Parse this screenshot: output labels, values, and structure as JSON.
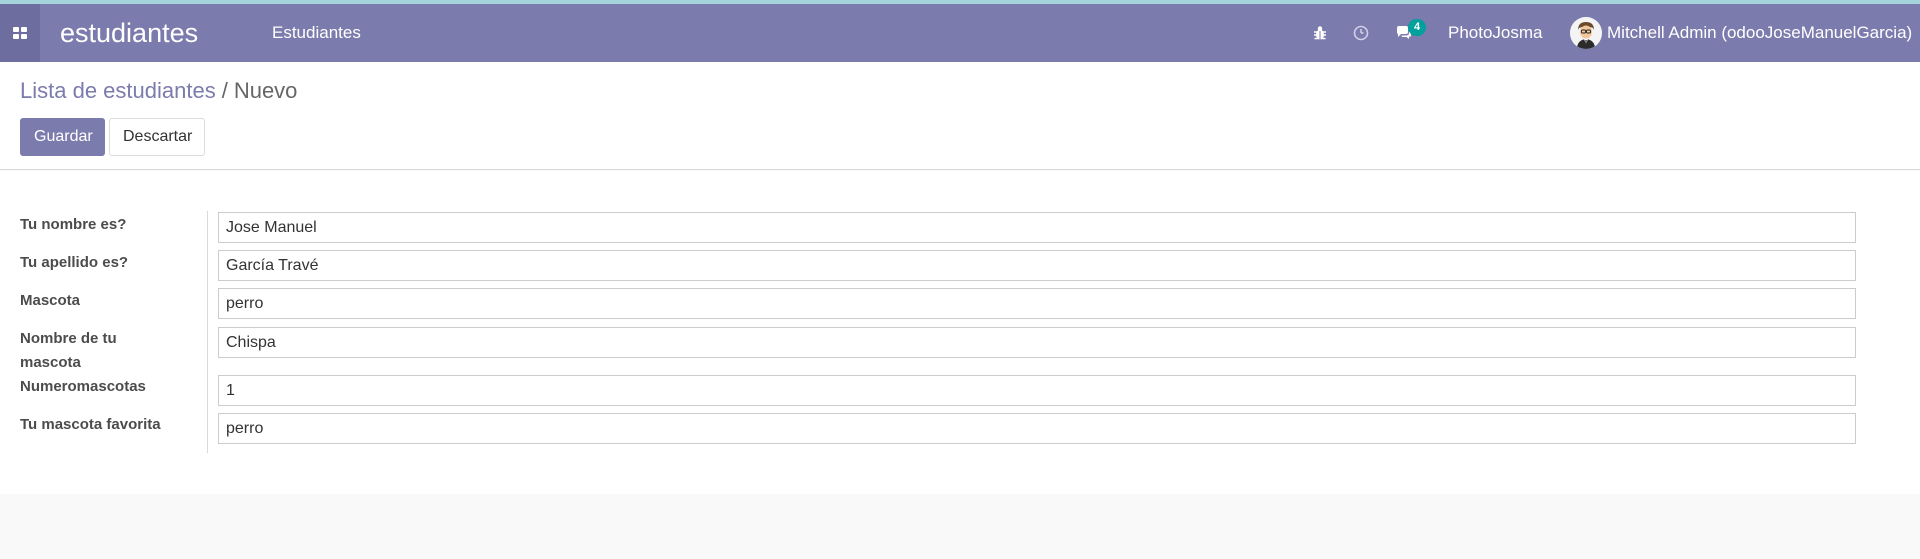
{
  "navbar": {
    "app_name": "estudiantes",
    "menu": [
      {
        "label": "Estudiantes"
      }
    ],
    "messages_count": "4",
    "company": "PhotoJosma",
    "user_name": "Mitchell Admin (odooJoseManuelGarcia)",
    "icons": [
      "apps-grid-icon",
      "bug-icon",
      "clock-icon",
      "chat-icon"
    ],
    "colors": {
      "navbar": "#7c7bad",
      "badge": "#00a09d"
    }
  },
  "control_panel": {
    "breadcrumb": {
      "parent": "Lista de estudiantes",
      "separator": "/",
      "current": "Nuevo"
    },
    "save_label": "Guardar",
    "discard_label": "Descartar"
  },
  "form": {
    "fields": [
      {
        "label": "Tu nombre es?",
        "value": "Jose Manuel"
      },
      {
        "label": "Tu apellido es?",
        "value": "García Travé"
      },
      {
        "label": "Mascota",
        "value": "perro"
      },
      {
        "label": "Nombre de tu mascota",
        "value": "Chispa"
      },
      {
        "label": "Numeromascotas",
        "value": "1"
      },
      {
        "label": "Tu mascota favorita",
        "value": "perro"
      }
    ]
  }
}
